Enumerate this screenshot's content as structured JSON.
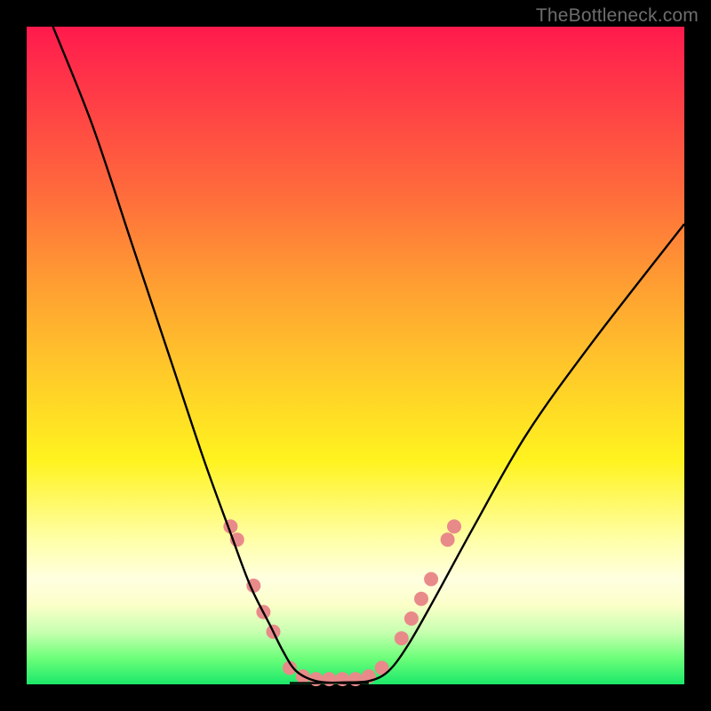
{
  "watermark": "TheBottleneck.com",
  "colors": {
    "background": "#000000",
    "curve_stroke": "#000000",
    "bead_fill": "#e98a8a",
    "gradient_stops": [
      "#ff1a4d",
      "#ff6a3c",
      "#ffc82a",
      "#fff31f",
      "#ffffe0",
      "#1be86a"
    ]
  },
  "chart_data": {
    "type": "line",
    "title": "",
    "xlabel": "",
    "ylabel": "",
    "xlim": [
      0,
      100
    ],
    "ylim": [
      0,
      100
    ],
    "note": "Bottleneck-style V-curve. Two curves descend from top, flatten to ~0 around x≈40–52, then one rises toward upper right. Small pink beads cluster along the lower walls and flat bottom.",
    "series": [
      {
        "name": "left-curve",
        "x": [
          4,
          10,
          16,
          22,
          27,
          31,
          34,
          37,
          39,
          41,
          44,
          48,
          52
        ],
        "y": [
          100,
          85,
          67,
          49,
          34,
          23,
          15,
          9,
          5,
          2,
          0.5,
          0.2,
          0.2
        ]
      },
      {
        "name": "right-curve",
        "x": [
          40,
          44,
          48,
          52,
          55,
          58,
          62,
          68,
          76,
          86,
          100
        ],
        "y": [
          0.2,
          0.2,
          0.3,
          0.5,
          2,
          6,
          13,
          24,
          38,
          52,
          70
        ]
      }
    ],
    "beads": {
      "comment": "pink dots along lower V walls and flat; x/y in same 0–100 space",
      "points": [
        {
          "x": 31,
          "y": 24
        },
        {
          "x": 32,
          "y": 22
        },
        {
          "x": 34.5,
          "y": 15
        },
        {
          "x": 36,
          "y": 11
        },
        {
          "x": 37.5,
          "y": 8
        },
        {
          "x": 40,
          "y": 2.5
        },
        {
          "x": 42,
          "y": 1.2
        },
        {
          "x": 44,
          "y": 0.8
        },
        {
          "x": 46,
          "y": 0.8
        },
        {
          "x": 48,
          "y": 0.8
        },
        {
          "x": 50,
          "y": 0.8
        },
        {
          "x": 52,
          "y": 1.2
        },
        {
          "x": 54,
          "y": 2.5
        },
        {
          "x": 57,
          "y": 7
        },
        {
          "x": 58.5,
          "y": 10
        },
        {
          "x": 60,
          "y": 13
        },
        {
          "x": 61.5,
          "y": 16
        },
        {
          "x": 64,
          "y": 22
        },
        {
          "x": 65,
          "y": 24
        }
      ],
      "radius_px": 8
    }
  }
}
